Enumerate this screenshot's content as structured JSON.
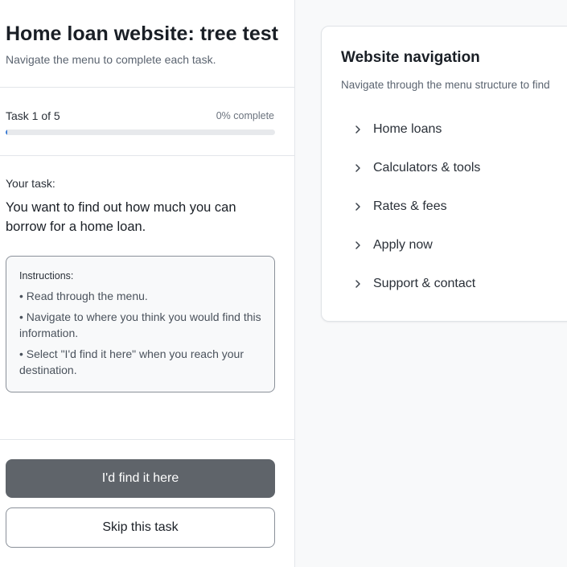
{
  "left_panel": {
    "title": "Home loan website: tree test",
    "subtitle": "Navigate the menu to complete each task.",
    "task_count": "Task 1 of 5",
    "progress_label": "0% complete",
    "progress_percent": 0,
    "task_heading": "Your task:",
    "task_text": "You want to find out how much you can borrow for a home loan.",
    "instructions": {
      "title": "Instructions:",
      "items": [
        "• Read through the menu.",
        "• Navigate to where you think you would find this information.",
        "• Select \"I'd find it here\" when you reach your destination."
      ]
    },
    "primary_button": "I'd find it here",
    "secondary_button": "Skip this task"
  },
  "navigation": {
    "title": "Website navigation",
    "subtitle": "Navigate through the menu structure to find",
    "items": [
      {
        "label": "Home loans",
        "icon": "chevron-right-icon"
      },
      {
        "label": "Calculators & tools",
        "icon": "chevron-right-icon"
      },
      {
        "label": "Rates & fees",
        "icon": "chevron-right-icon"
      },
      {
        "label": "Apply now",
        "icon": "chevron-right-icon"
      },
      {
        "label": "Support & contact",
        "icon": "chevron-right-icon"
      }
    ]
  },
  "colors": {
    "primary_button_bg": "#5f646a",
    "progress_fill": "#3a7bd5",
    "right_panel_bg": "#f8f9fa"
  }
}
